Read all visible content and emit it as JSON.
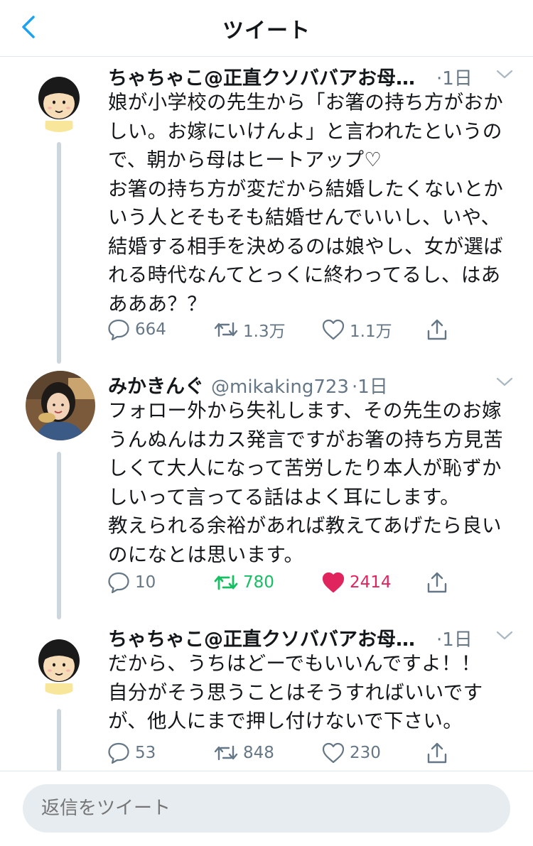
{
  "header": {
    "title": "ツイート"
  },
  "tweets": [
    {
      "name": "ちゃちゃこ@正直クソババアお母",
      "name_ellipsis": "…",
      "handle": "",
      "time": "·1日",
      "body": "娘が小学校の先生から「お箸の持ち方がおか\nしい。お嫁にいけんよ」と言われたというの\nで、朝から母はヒートアップ♡\nお箸の持ち方が変だから結婚したくないとか\nいう人とそもそも結婚せんでいいし、いや、\n結婚する相手を決めるのは娘やし、女が選ば\nれる時代なんてとっくに終わってるし、はあ\nあああ？？",
      "replies": "664",
      "retweets": "1.3万",
      "likes": "1.1万",
      "retweeted": false,
      "liked": false
    },
    {
      "name": "みかきんぐ",
      "name_ellipsis": "",
      "handle": "@mikaking723",
      "time": "·1日",
      "body": "フォロー外から失礼します、その先生のお嫁\nうんぬんはカス発言ですがお箸の持ち方見苦\nしくて大人になって苦労したり本人が恥ずか\nしいって言ってる話はよく耳にします。\n教えられる余裕があれば教えてあげたら良い\nのになとは思います。",
      "replies": "10",
      "retweets": "780",
      "likes": "2414",
      "retweeted": true,
      "liked": true
    },
    {
      "name": "ちゃちゃこ@正直クソババアお母",
      "name_ellipsis": "…",
      "handle": "",
      "time": "·1日",
      "body": "だから、うちはどーでもいいんですよ！！\n自分がそう思うことはそうすればいいです\nが、他人にまで押し付けないで下さい。",
      "replies": "53",
      "retweets": "848",
      "likes": "230",
      "retweeted": false,
      "liked": false
    }
  ],
  "reply": {
    "placeholder": "返信をツイート"
  },
  "colors": {
    "accent": "#1da1f2",
    "retweet_active": "#17bf63",
    "like_active": "#e0245e",
    "secondary_text": "#657786",
    "thread_line": "#ccd6dd"
  },
  "icons": {
    "back": "chevron-left-icon",
    "caret": "chevron-down-icon",
    "reply": "reply-bubble-icon",
    "retweet": "retweet-icon",
    "like": "heart-icon",
    "share": "share-icon"
  }
}
